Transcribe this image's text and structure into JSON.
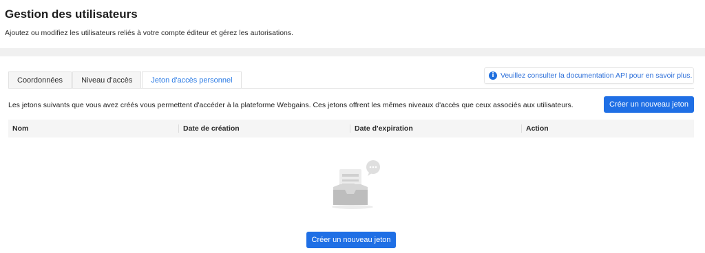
{
  "header": {
    "title": "Gestion des utilisateurs",
    "subtitle": "Ajoutez ou modifiez les utilisateurs reliés à votre compte éditeur et gérez les autorisations."
  },
  "tabs": [
    {
      "label": "Coordonnées",
      "active": false
    },
    {
      "label": "Niveau d'accès",
      "active": false
    },
    {
      "label": "Jeton d'accès personnel",
      "active": true
    }
  ],
  "info": {
    "text": "Veuillez consulter la documentation API pour en savoir plus.",
    "icon": "info-icon"
  },
  "description": "Les jetons suivants que vous avez créés vous permettent d'accéder à la plateforme Webgains. Ces jetons offrent les mêmes niveaux d'accès que ceux associés aux utilisateurs.",
  "create_button_label": "Créer un nouveau jeton",
  "table": {
    "columns": [
      "Nom",
      "Date de création",
      "Date d'expiration",
      "Action"
    ],
    "rows": []
  },
  "empty_state": {
    "icon": "empty-inbox-icon",
    "button_label": "Créer un nouveau jeton"
  },
  "colors": {
    "accent": "#1f6fe5",
    "link": "#2b6ed9"
  }
}
